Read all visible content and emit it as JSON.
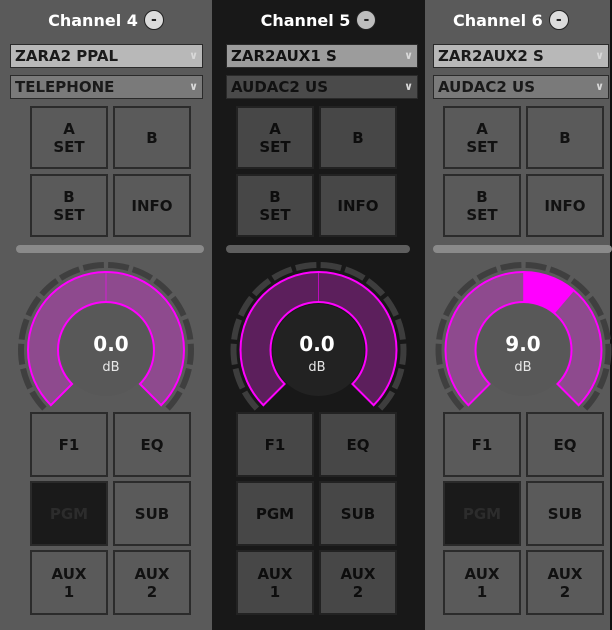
{
  "channels": [
    {
      "title": "Channel 4",
      "minus_label": "-",
      "source": "ZARA2 PPAL",
      "destination": "TELEPHONE",
      "buttons_top": [
        "A\nSET",
        "B",
        "B\nSET",
        "INFO"
      ],
      "gain_value": "0.0",
      "gain_unit": "dB",
      "gain_fraction": 0.0,
      "buttons_bottom": [
        "F1",
        "EQ",
        "PGM",
        "SUB",
        "AUX\n1",
        "AUX\n2"
      ],
      "pgm_active": true
    },
    {
      "title": "Channel 5",
      "minus_label": "-",
      "source": "ZAR2AUX1 S",
      "destination": "AUDAC2 US",
      "buttons_top": [
        "A\nSET",
        "B",
        "B\nSET",
        "INFO"
      ],
      "gain_value": "0.0",
      "gain_unit": "dB",
      "gain_fraction": 0.0,
      "buttons_bottom": [
        "F1",
        "EQ",
        "PGM",
        "SUB",
        "AUX\n1",
        "AUX\n2"
      ],
      "pgm_active": true
    },
    {
      "title": "Channel 6",
      "minus_label": "-",
      "source": "ZAR2AUX2 S",
      "destination": "AUDAC2 US",
      "buttons_top": [
        "A\nSET",
        "B",
        "B\nSET",
        "INFO"
      ],
      "gain_value": "9.0",
      "gain_unit": "dB",
      "gain_fraction": 0.15,
      "buttons_bottom": [
        "F1",
        "EQ",
        "PGM",
        "SUB",
        "AUX\n1",
        "AUX\n2"
      ],
      "pgm_active": true
    }
  ],
  "icons": {
    "dropdown": "chevron-down-icon",
    "minus": "minus-circle-icon"
  },
  "colors": {
    "accent": "#ff00ff",
    "ring_fill_light": "#8e4a8e",
    "ring_fill_dark": "#5c1f5c"
  }
}
